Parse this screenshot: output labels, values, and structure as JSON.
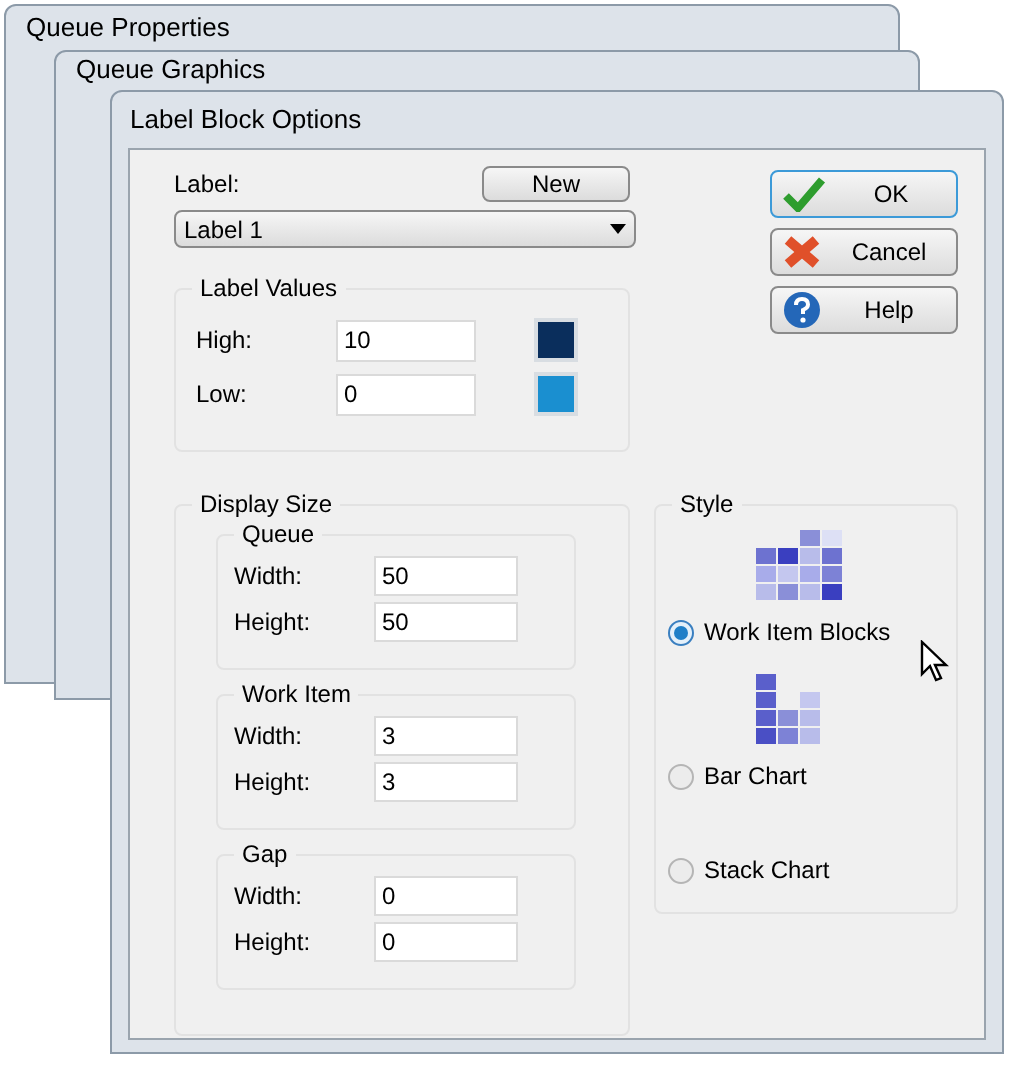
{
  "background_windows": [
    {
      "title": "Queue Properties"
    },
    {
      "title": "Queue Graphics"
    }
  ],
  "dialog": {
    "title": "Label Block Options",
    "label": {
      "caption": "Label:",
      "new_button": "New",
      "value": "Label 1"
    },
    "label_values": {
      "title": "Label Values",
      "rows": [
        {
          "label": "High:",
          "value": "10",
          "color": "#0a2e5c"
        },
        {
          "label": "Low:",
          "value": "0",
          "color": "#1a8fd0"
        }
      ]
    },
    "buttons": [
      {
        "kind": "ok",
        "label": "OK"
      },
      {
        "kind": "cancel",
        "label": "Cancel"
      },
      {
        "kind": "help",
        "label": "Help"
      }
    ],
    "display_size": {
      "title": "Display Size",
      "groups": [
        {
          "title": "Queue",
          "fields": [
            {
              "label": "Width:",
              "value": "50"
            },
            {
              "label": "Height:",
              "value": "50"
            }
          ]
        },
        {
          "title": "Work Item",
          "fields": [
            {
              "label": "Width:",
              "value": "3"
            },
            {
              "label": "Height:",
              "value": "3"
            }
          ]
        },
        {
          "title": "Gap",
          "fields": [
            {
              "label": "Width:",
              "value": "0"
            },
            {
              "label": "Height:",
              "value": "0"
            }
          ]
        }
      ]
    },
    "style": {
      "title": "Style",
      "options": [
        {
          "kind": "blocks",
          "label": "Work Item Blocks",
          "selected": true
        },
        {
          "kind": "bars",
          "label": "Bar Chart",
          "selected": false
        },
        {
          "kind": "stack",
          "label": "Stack Chart",
          "selected": false
        }
      ]
    }
  }
}
